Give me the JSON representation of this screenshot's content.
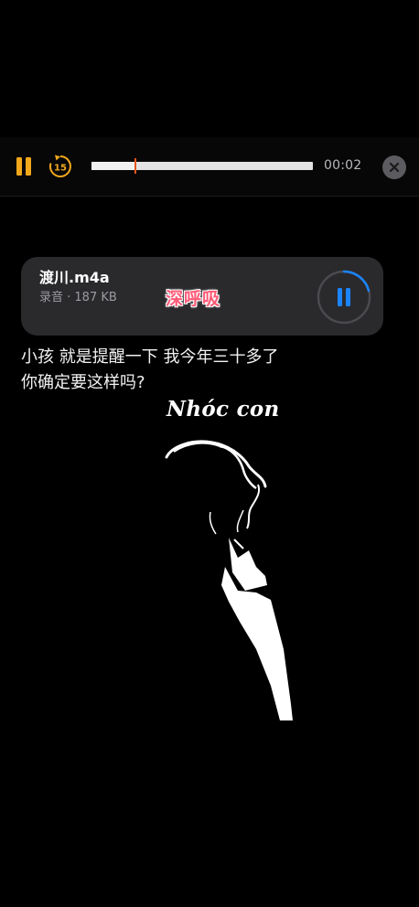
{
  "player": {
    "elapsed": "00:02",
    "skip_seconds": "15",
    "progress": 0.2
  },
  "file": {
    "name": "渡川.m4a",
    "meta": "录音 · 187 KB"
  },
  "overlay": {
    "stamp": "深呼吸",
    "message_line1": "小孩 就是提醒一下 我今年三十多了",
    "message_line2": "你确定要这样吗?",
    "caption": "Nhóc con"
  },
  "colors": {
    "accent_orange": "#f3a81c",
    "accent_blue": "#1a84ff",
    "playhead_red": "#e6561d"
  },
  "icons": [
    "pause-icon",
    "skip-back-15-icon",
    "close-icon",
    "pause-circle-icon"
  ]
}
